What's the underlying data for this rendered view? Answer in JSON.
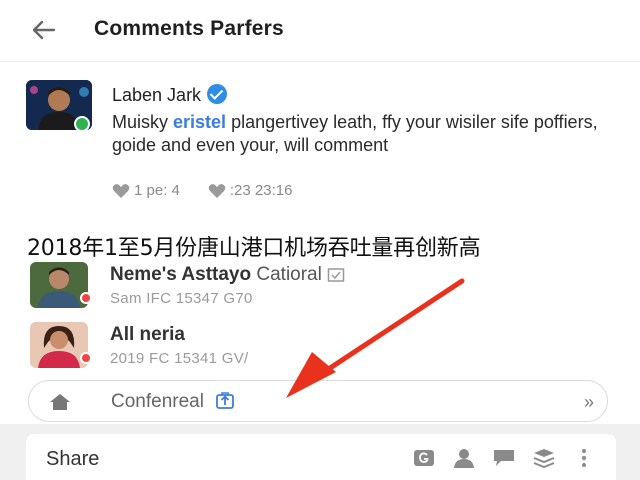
{
  "header": {
    "title": "Comments Parfers"
  },
  "comment": {
    "author": "Laben Jark",
    "text_before": "Muisky ",
    "mention": "eristel",
    "text_after": " plangertivey leath, ffy your wisiler sife poffiers, goide and even your, will comment",
    "stat_1": "1 pe: 4",
    "stat_2": ":23 23:16"
  },
  "overlay_caption": "2018年1至5月份唐山港口机场吞吐量再创新高",
  "users": [
    {
      "name": "Neme's Asttayo",
      "subtitle": "Catioral",
      "meta": "Sam IFC    15347  G70"
    },
    {
      "name": "All neria",
      "subtitle": "",
      "meta": "2019 FC    15341  GV/"
    }
  ],
  "confenreal": {
    "label": "Confenreal",
    "chevron": "»"
  },
  "share": {
    "label": "Share"
  },
  "colors": {
    "mention": "#3c7be0",
    "verified": "#2f8de4",
    "arrow": "#e8321e"
  },
  "icons": [
    "back-arrow-icon",
    "verified-icon",
    "heart-icon",
    "home-icon",
    "upload-icon",
    "chevron-double-right-icon",
    "g-icon",
    "person-icon",
    "chat-icon",
    "layers-icon",
    "more-icon"
  ]
}
